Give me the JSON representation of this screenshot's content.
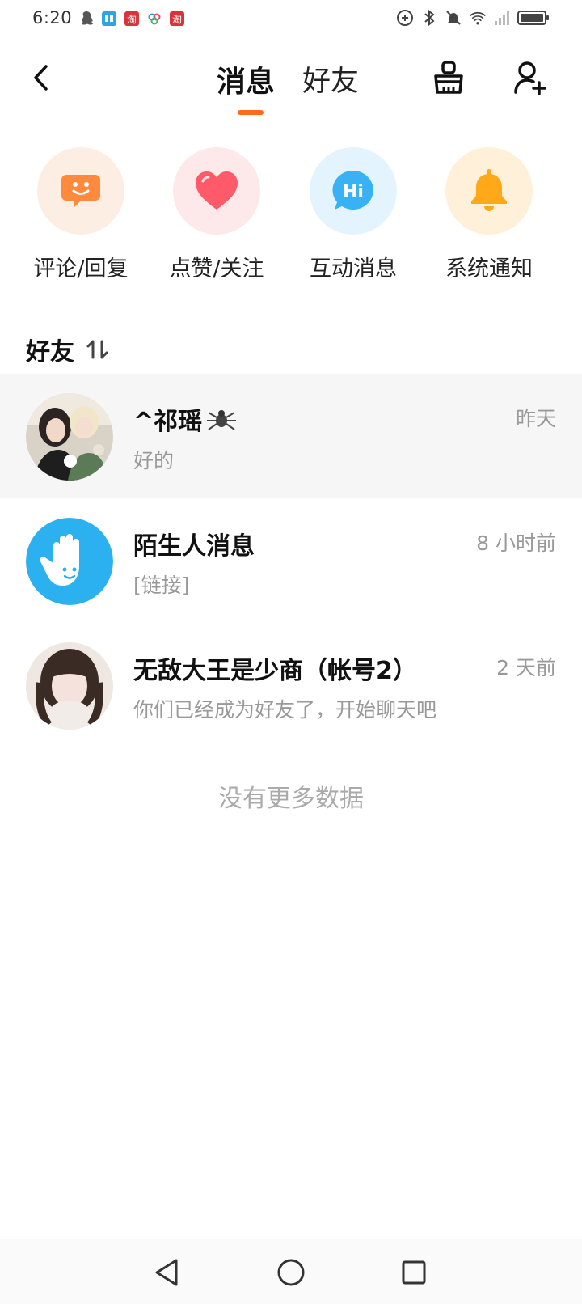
{
  "status_bar": {
    "time": "6:20",
    "left_icons": [
      "qq-icon",
      "reader-app-icon",
      "taobao-icon",
      "connect-app-icon",
      "taobao-icon"
    ],
    "right_icons": [
      "data-saver-icon",
      "bluetooth-icon",
      "mute-icon",
      "wifi-icon",
      "signal-icon",
      "battery-icon"
    ]
  },
  "header": {
    "tab_messages": "消息",
    "tab_friends": "好友",
    "active_tab": "消息",
    "accent_color": "#ff6a1a"
  },
  "quick_actions": [
    {
      "label": "评论/回复",
      "icon": "comment-face-icon",
      "bg": "#fdeee3",
      "color": "#ff8a3d"
    },
    {
      "label": "点赞/关注",
      "icon": "heart-icon",
      "bg": "#fde9e9",
      "color": "#ff5a6a"
    },
    {
      "label": "互动消息",
      "icon": "hi-bubble-icon",
      "bg": "#e3f4fe",
      "color": "#38b2f4"
    },
    {
      "label": "系统通知",
      "icon": "bell-icon",
      "bg": "#fff1d9",
      "color": "#ffa81a"
    }
  ],
  "friends_section": {
    "title": "好友",
    "sort_icon": "sort-icon"
  },
  "conversations": [
    {
      "name": "^祁瑶",
      "name_icon": "spider-icon",
      "preview": "好的",
      "time": "昨天"
    },
    {
      "name": "陌生人消息",
      "preview": "[链接]",
      "time": "8 小时前"
    },
    {
      "name": "无敌大王是少商（帐号2）",
      "preview": "你们已经成为好友了，开始聊天吧",
      "time": "2 天前"
    }
  ],
  "footer_text": "没有更多数据"
}
